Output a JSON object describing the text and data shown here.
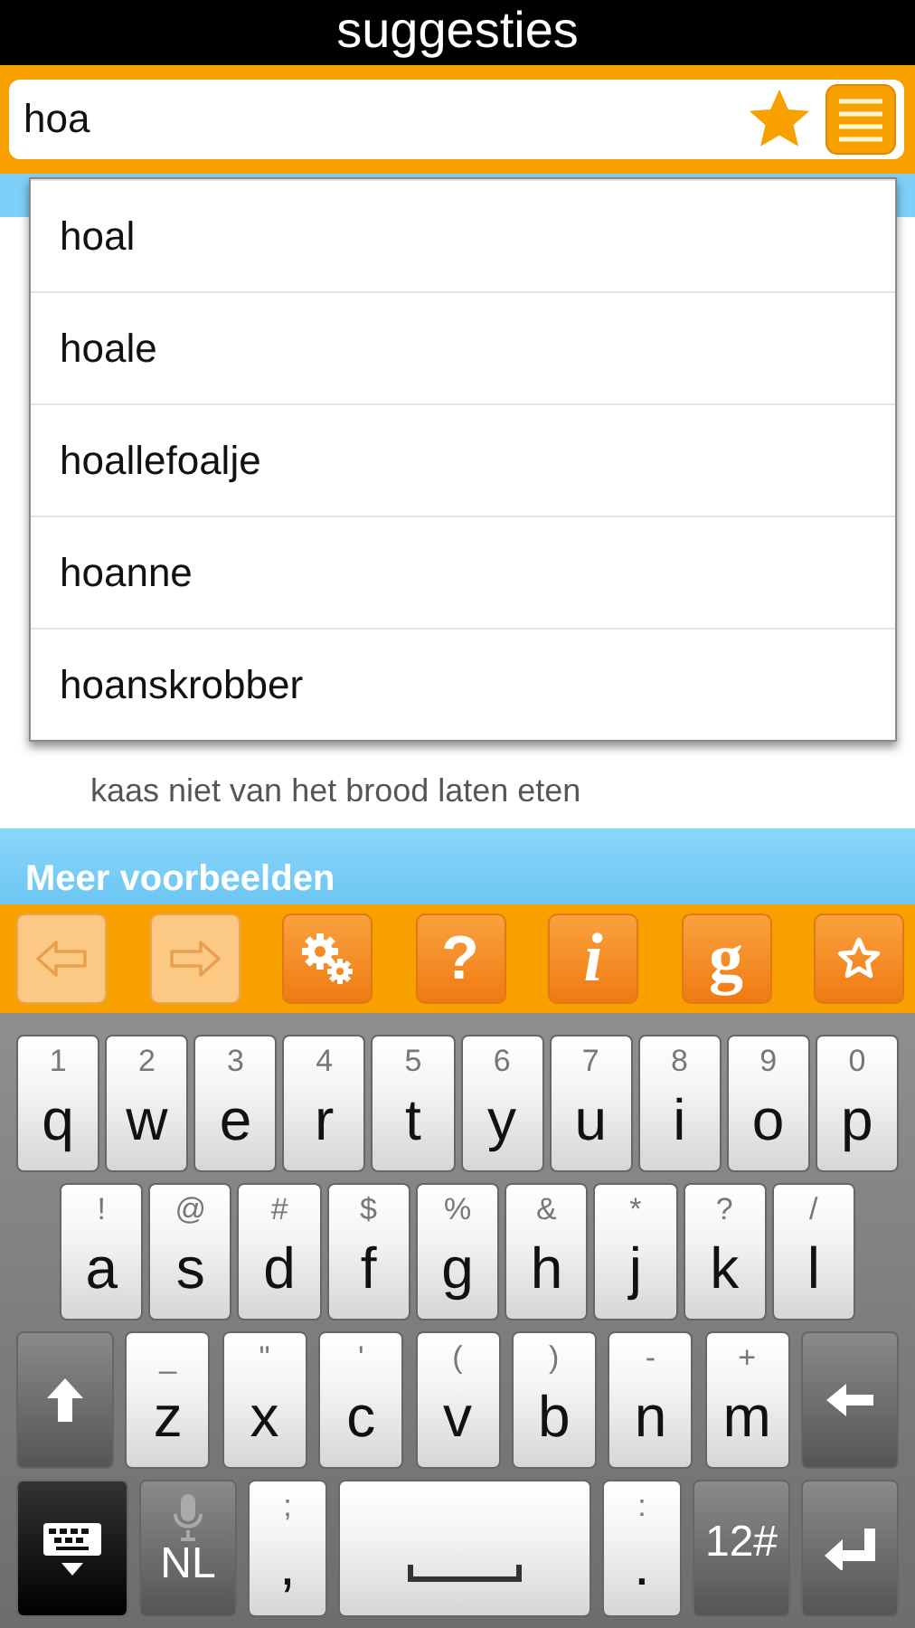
{
  "title": "suggesties",
  "search": {
    "value": "hoa"
  },
  "suggestions": [
    {
      "text": "hoal"
    },
    {
      "text": "hoale"
    },
    {
      "text": "hoallefoalje"
    },
    {
      "text": "hoanne"
    },
    {
      "text": "hoanskrobber"
    }
  ],
  "content": {
    "text": "kaas niet van het brood laten eten"
  },
  "section_header": "Meer voorbeelden",
  "toolbar": [
    {
      "kind": "back",
      "disabled": true
    },
    {
      "kind": "forward",
      "disabled": true
    },
    {
      "kind": "settings",
      "disabled": false
    },
    {
      "kind": "help",
      "label": "?",
      "disabled": false
    },
    {
      "kind": "info",
      "label": "i",
      "disabled": false
    },
    {
      "kind": "google",
      "label": "g",
      "disabled": false
    },
    {
      "kind": "favorites",
      "disabled": false
    }
  ],
  "keyboard": [
    [
      {
        "kind": "char",
        "main": "q",
        "alt": "1"
      },
      {
        "kind": "char",
        "main": "w",
        "alt": "2"
      },
      {
        "kind": "char",
        "main": "e",
        "alt": "3"
      },
      {
        "kind": "char",
        "main": "r",
        "alt": "4"
      },
      {
        "kind": "char",
        "main": "t",
        "alt": "5"
      },
      {
        "kind": "char",
        "main": "y",
        "alt": "6"
      },
      {
        "kind": "char",
        "main": "u",
        "alt": "7"
      },
      {
        "kind": "char",
        "main": "i",
        "alt": "8"
      },
      {
        "kind": "char",
        "main": "o",
        "alt": "9"
      },
      {
        "kind": "char",
        "main": "p",
        "alt": "0"
      }
    ],
    [
      {
        "kind": "char",
        "main": "a",
        "alt": "!"
      },
      {
        "kind": "char",
        "main": "s",
        "alt": "@"
      },
      {
        "kind": "char",
        "main": "d",
        "alt": "#"
      },
      {
        "kind": "char",
        "main": "f",
        "alt": "$"
      },
      {
        "kind": "char",
        "main": "g",
        "alt": "%"
      },
      {
        "kind": "char",
        "main": "h",
        "alt": "&"
      },
      {
        "kind": "char",
        "main": "j",
        "alt": "*"
      },
      {
        "kind": "char",
        "main": "k",
        "alt": "?"
      },
      {
        "kind": "char",
        "main": "l",
        "alt": "/"
      }
    ],
    [
      {
        "kind": "shift"
      },
      {
        "kind": "char",
        "main": "z",
        "alt": "_"
      },
      {
        "kind": "char",
        "main": "x",
        "alt": "\""
      },
      {
        "kind": "char",
        "main": "c",
        "alt": "'"
      },
      {
        "kind": "char",
        "main": "v",
        "alt": "("
      },
      {
        "kind": "char",
        "main": "b",
        "alt": ")"
      },
      {
        "kind": "char",
        "main": "n",
        "alt": "-"
      },
      {
        "kind": "char",
        "main": "m",
        "alt": "+"
      },
      {
        "kind": "backspace"
      }
    ],
    [
      {
        "kind": "hide"
      },
      {
        "kind": "lang",
        "main": "NL"
      },
      {
        "kind": "punct",
        "main": ",",
        "alt": ";"
      },
      {
        "kind": "space"
      },
      {
        "kind": "punct",
        "main": ".",
        "alt": ":"
      },
      {
        "kind": "symbols",
        "main": "12#"
      },
      {
        "kind": "enter"
      }
    ]
  ]
}
